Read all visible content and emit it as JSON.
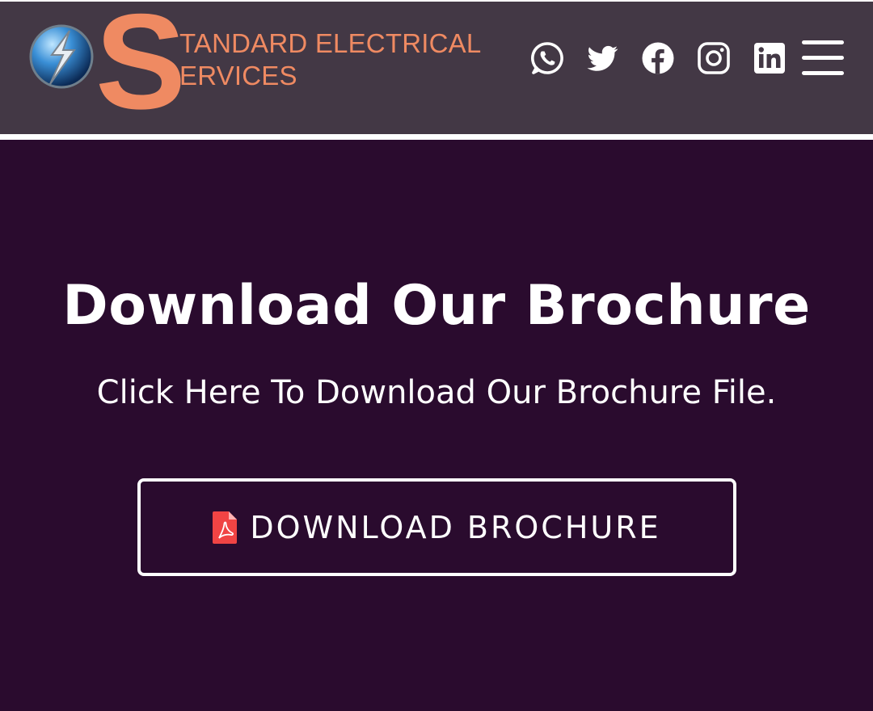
{
  "header": {
    "logo": {
      "big_letter": "S",
      "line1": "TANDARD ELECTRICAL",
      "line2": "ERVICES",
      "accent_color": "#ef8a62"
    },
    "social_icons": [
      "whatsapp-icon",
      "twitter-icon",
      "facebook-icon",
      "instagram-icon",
      "linkedin-icon"
    ],
    "menu_icon": "hamburger-menu-icon",
    "background": "#433845"
  },
  "main": {
    "background": "#2a0b2e",
    "headline": "Download Our Brochure",
    "subline": "Click Here To Download Our Brochure File.",
    "button": {
      "label": "DOWNLOAD BROCHURE",
      "icon": "pdf-file-icon",
      "icon_color": "#f04444"
    }
  }
}
